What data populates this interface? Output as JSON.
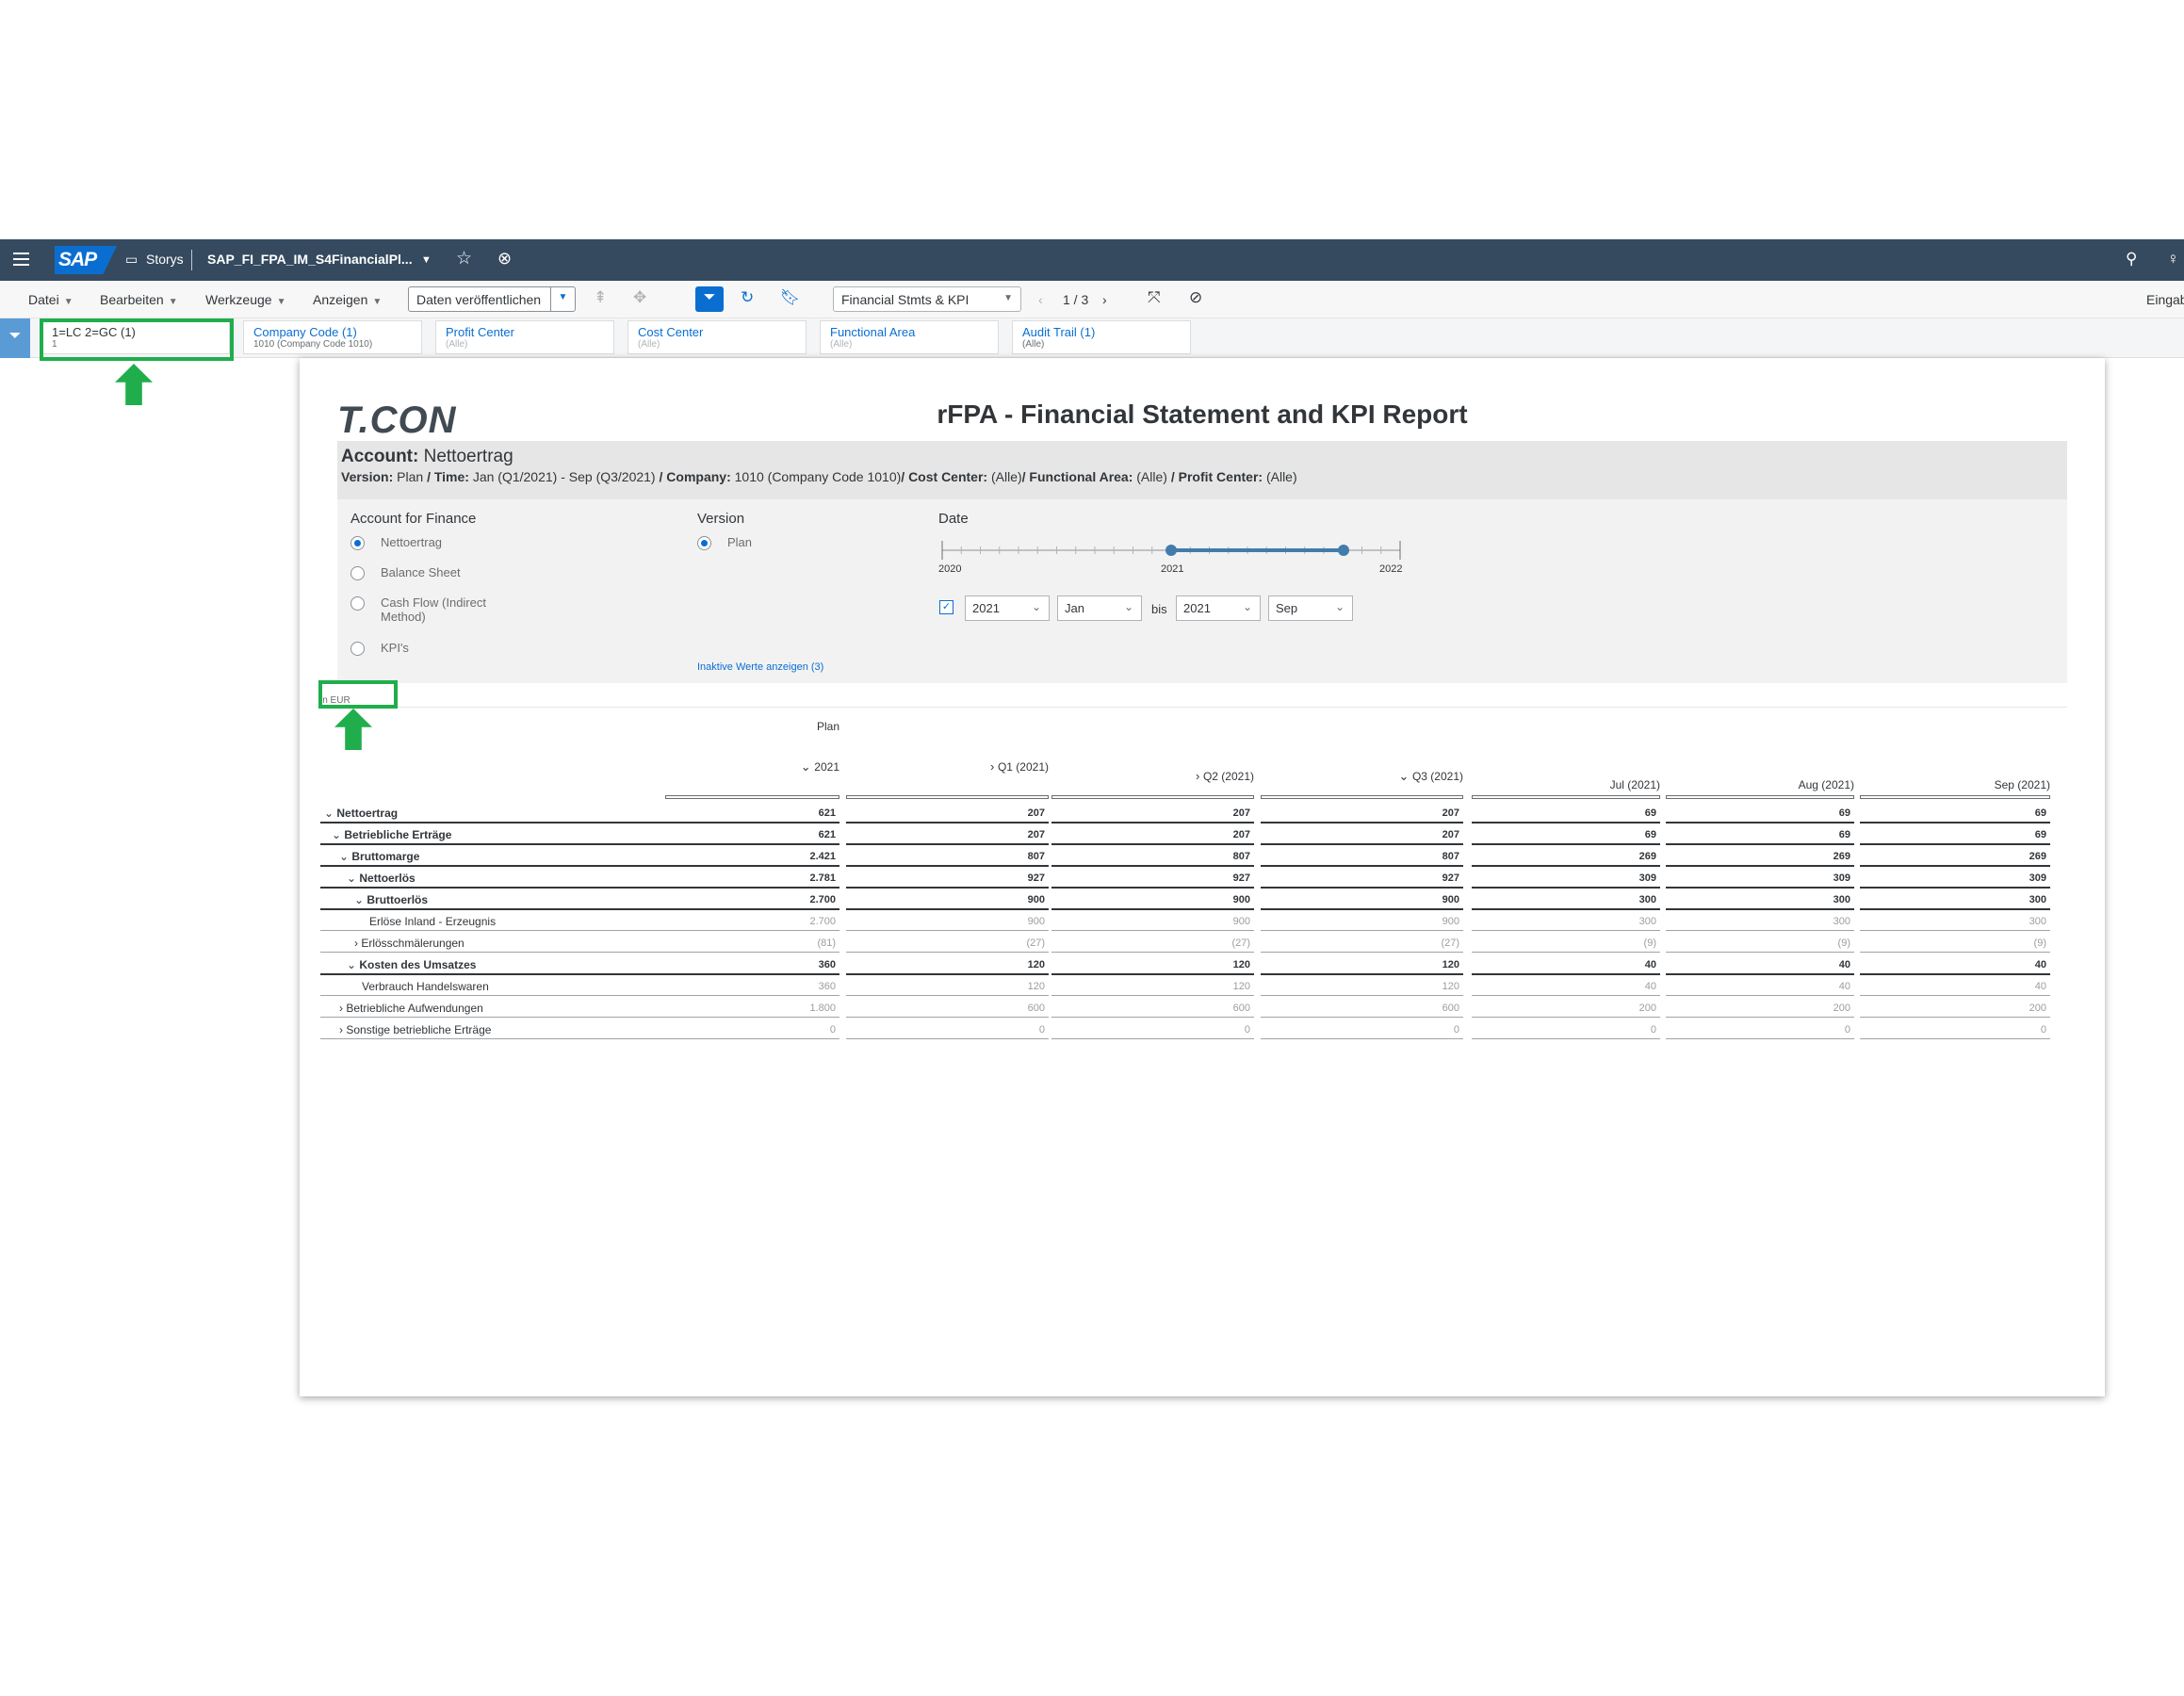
{
  "shell": {
    "stories_label": "Storys",
    "story_name": "SAP_FI_FPA_IM_S4FinancialPl..."
  },
  "toolbar": {
    "menus": [
      "Datei",
      "Bearbeiten",
      "Werkzeuge",
      "Anzeigen"
    ],
    "publish_button": "Daten veröffentlichen",
    "page_select": "Financial Stmts & KPI",
    "page_counter": "1 / 3",
    "right_text": "Eingab"
  },
  "filters": [
    {
      "label": "1=LC 2=GC (1)",
      "value": "1"
    },
    {
      "label": "Company Code (1)",
      "value": "1010 (Company Code 1010)"
    },
    {
      "label": "Profit Center",
      "value": "(Alle)"
    },
    {
      "label": "Cost Center",
      "value": "(Alle)"
    },
    {
      "label": "Functional Area",
      "value": "(Alle)"
    },
    {
      "label": "Audit Trail (1)",
      "value": "(Alle)"
    }
  ],
  "report": {
    "logo": "T.CON",
    "title": "rFPA - Financial Statement and KPI Report",
    "account_label": "Account:",
    "account_value": "Nettoertrag",
    "context_line": [
      {
        "b": "Version:",
        "t": " Plan "
      },
      {
        "b": "/ Time:",
        "t": " Jan (Q1/2021) - Sep (Q3/2021) "
      },
      {
        "b": "/ Company:",
        "t": " 1010 (Company Code 1010)"
      },
      {
        "b": "/ Cost Center:",
        "t": " (Alle)"
      },
      {
        "b": "/ Functional Area:",
        "t": " (Alle) "
      },
      {
        "b": "/ Profit Center:",
        "t": " (Alle)"
      }
    ]
  },
  "controls": {
    "account_header": "Account for Finance",
    "account_options": [
      {
        "label": "Nettoertrag",
        "selected": true
      },
      {
        "label": "Balance Sheet",
        "selected": false
      },
      {
        "label": "Cash Flow (Indirect Method)",
        "selected": false
      },
      {
        "label": "KPI's",
        "selected": false
      }
    ],
    "version_header": "Version",
    "version_options": [
      {
        "label": "Plan",
        "selected": true
      }
    ],
    "inactive_link": "Inaktive Werte anzeigen (3)",
    "date_header": "Date",
    "slider_labels": [
      "2020",
      "2021",
      "2022"
    ],
    "from_year": "2021",
    "from_month": "Jan",
    "bis": "bis",
    "to_year": "2021",
    "to_month": "Sep"
  },
  "table": {
    "unit": "in EUR",
    "version_header": "Plan",
    "columns": [
      "2021",
      "Q1 (2021)",
      "Q2 (2021)",
      "Q3 (2021)",
      "Jul (2021)",
      "Aug (2021)",
      "Sep (2021)"
    ],
    "rows": [
      {
        "label": "Nettoertrag",
        "indent": 0,
        "toggle": "down",
        "bold": true,
        "values": [
          "621",
          "207",
          "207",
          "207",
          "69",
          "69",
          "69"
        ]
      },
      {
        "label": "Betriebliche Erträge",
        "indent": 1,
        "toggle": "down",
        "bold": true,
        "values": [
          "621",
          "207",
          "207",
          "207",
          "69",
          "69",
          "69"
        ]
      },
      {
        "label": "Bruttomarge",
        "indent": 2,
        "toggle": "down",
        "bold": true,
        "values": [
          "2.421",
          "807",
          "807",
          "807",
          "269",
          "269",
          "269"
        ]
      },
      {
        "label": "Nettoerlös",
        "indent": 3,
        "toggle": "down",
        "bold": true,
        "values": [
          "2.781",
          "927",
          "927",
          "927",
          "309",
          "309",
          "309"
        ]
      },
      {
        "label": "Bruttoerlös",
        "indent": 4,
        "toggle": "down",
        "bold": true,
        "values": [
          "2.700",
          "900",
          "900",
          "900",
          "300",
          "300",
          "300"
        ]
      },
      {
        "label": "Erlöse Inland - Erzeugnis",
        "indent": 6,
        "toggle": "",
        "bold": false,
        "values": [
          "2.700",
          "900",
          "900",
          "900",
          "300",
          "300",
          "300"
        ]
      },
      {
        "label": "Erlösschmälerungen",
        "indent": 4,
        "toggle": "right",
        "bold": false,
        "values": [
          "(81)",
          "(27)",
          "(27)",
          "(27)",
          "(9)",
          "(9)",
          "(9)"
        ]
      },
      {
        "label": "Kosten des Umsatzes",
        "indent": 3,
        "toggle": "down",
        "bold": true,
        "values": [
          "360",
          "120",
          "120",
          "120",
          "40",
          "40",
          "40"
        ]
      },
      {
        "label": "Verbrauch Handelswaren",
        "indent": 5,
        "toggle": "",
        "bold": false,
        "values": [
          "360",
          "120",
          "120",
          "120",
          "40",
          "40",
          "40"
        ]
      },
      {
        "label": "Betriebliche Aufwendungen",
        "indent": 2,
        "toggle": "right",
        "bold": false,
        "values": [
          "1.800",
          "600",
          "600",
          "600",
          "200",
          "200",
          "200"
        ]
      },
      {
        "label": "Sonstige betriebliche Erträge",
        "indent": 2,
        "toggle": "right",
        "bold": false,
        "values": [
          "0",
          "0",
          "0",
          "0",
          "0",
          "0",
          "0"
        ]
      }
    ]
  },
  "colors": {
    "shell": "#354a5f",
    "accent": "#0a6ed1",
    "highlight": "#1fae4b",
    "slider": "#427cac"
  }
}
